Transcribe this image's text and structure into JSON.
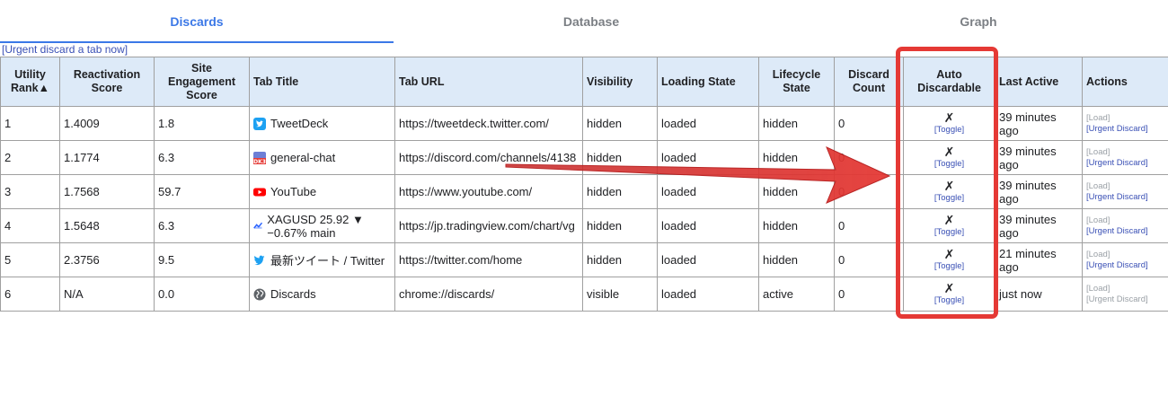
{
  "tabs": [
    {
      "label": "Discards",
      "active": true
    },
    {
      "label": "Database",
      "active": false
    },
    {
      "label": "Graph",
      "active": false
    }
  ],
  "urgent_discard_link": "[Urgent discard a tab now]",
  "columns": {
    "utility_rank": "Utility Rank▲",
    "reactivation_score": "Reactivation Score",
    "site_engagement_score": "Site Engagement Score",
    "tab_title": "Tab Title",
    "tab_url": "Tab URL",
    "visibility": "Visibility",
    "loading_state": "Loading State",
    "lifecycle_state": "Lifecycle State",
    "discard_count": "Discard Count",
    "auto_discardable": "Auto Discardable",
    "last_active": "Last Active",
    "actions": "Actions"
  },
  "rows": [
    {
      "rank": "1",
      "reactivation": "1.4009",
      "engagement": "1.8",
      "icon": "tweetdeck-icon",
      "title": "TweetDeck",
      "url": "https://tweetdeck.twitter.com/",
      "visibility": "hidden",
      "loading": "loaded",
      "lifecycle": "hidden",
      "discards": "0",
      "auto_mark": "✗",
      "toggle": "[Toggle]",
      "last_active": "39 minutes ago",
      "load": "[Load]",
      "urgent": "[Urgent Discard]"
    },
    {
      "rank": "2",
      "reactivation": "1.1774",
      "engagement": "6.3",
      "icon": "discord-icon",
      "title": "general-chat",
      "url": "https://discord.com/channels/4138",
      "visibility": "hidden",
      "loading": "loaded",
      "lifecycle": "hidden",
      "discards": "0",
      "auto_mark": "✗",
      "toggle": "[Toggle]",
      "last_active": "39 minutes ago",
      "load": "[Load]",
      "urgent": "[Urgent Discard]"
    },
    {
      "rank": "3",
      "reactivation": "1.7568",
      "engagement": "59.7",
      "icon": "youtube-icon",
      "title": "YouTube",
      "url": "https://www.youtube.com/",
      "visibility": "hidden",
      "loading": "loaded",
      "lifecycle": "hidden",
      "discards": "0",
      "auto_mark": "✗",
      "toggle": "[Toggle]",
      "last_active": "39 minutes ago",
      "load": "[Load]",
      "urgent": "[Urgent Discard]"
    },
    {
      "rank": "4",
      "reactivation": "1.5648",
      "engagement": "6.3",
      "icon": "tradingview-icon",
      "title": "XAGUSD 25.92 ▼ −0.67% main",
      "url": "https://jp.tradingview.com/chart/vg",
      "visibility": "hidden",
      "loading": "loaded",
      "lifecycle": "hidden",
      "discards": "0",
      "auto_mark": "✗",
      "toggle": "[Toggle]",
      "last_active": "39 minutes ago",
      "load": "[Load]",
      "urgent": "[Urgent Discard]"
    },
    {
      "rank": "5",
      "reactivation": "2.3756",
      "engagement": "9.5",
      "icon": "twitter-icon",
      "title": "最新ツイート / Twitter",
      "url": "https://twitter.com/home",
      "visibility": "hidden",
      "loading": "loaded",
      "lifecycle": "hidden",
      "discards": "0",
      "auto_mark": "✗",
      "toggle": "[Toggle]",
      "last_active": "21 minutes ago",
      "load": "[Load]",
      "urgent": "[Urgent Discard]"
    },
    {
      "rank": "6",
      "reactivation": "N/A",
      "engagement": "0.0",
      "icon": "globe-icon",
      "title": "Discards",
      "url": "chrome://discards/",
      "visibility": "visible",
      "loading": "loaded",
      "lifecycle": "active",
      "discards": "0",
      "auto_mark": "✗",
      "toggle": "[Toggle]",
      "last_active": "just now",
      "load": "[Load]",
      "urgent": "[Urgent Discard]"
    }
  ],
  "colors": {
    "accent": "#3b78e7",
    "header_bg": "#ddeaf8",
    "annotation_red": "#e53935"
  }
}
